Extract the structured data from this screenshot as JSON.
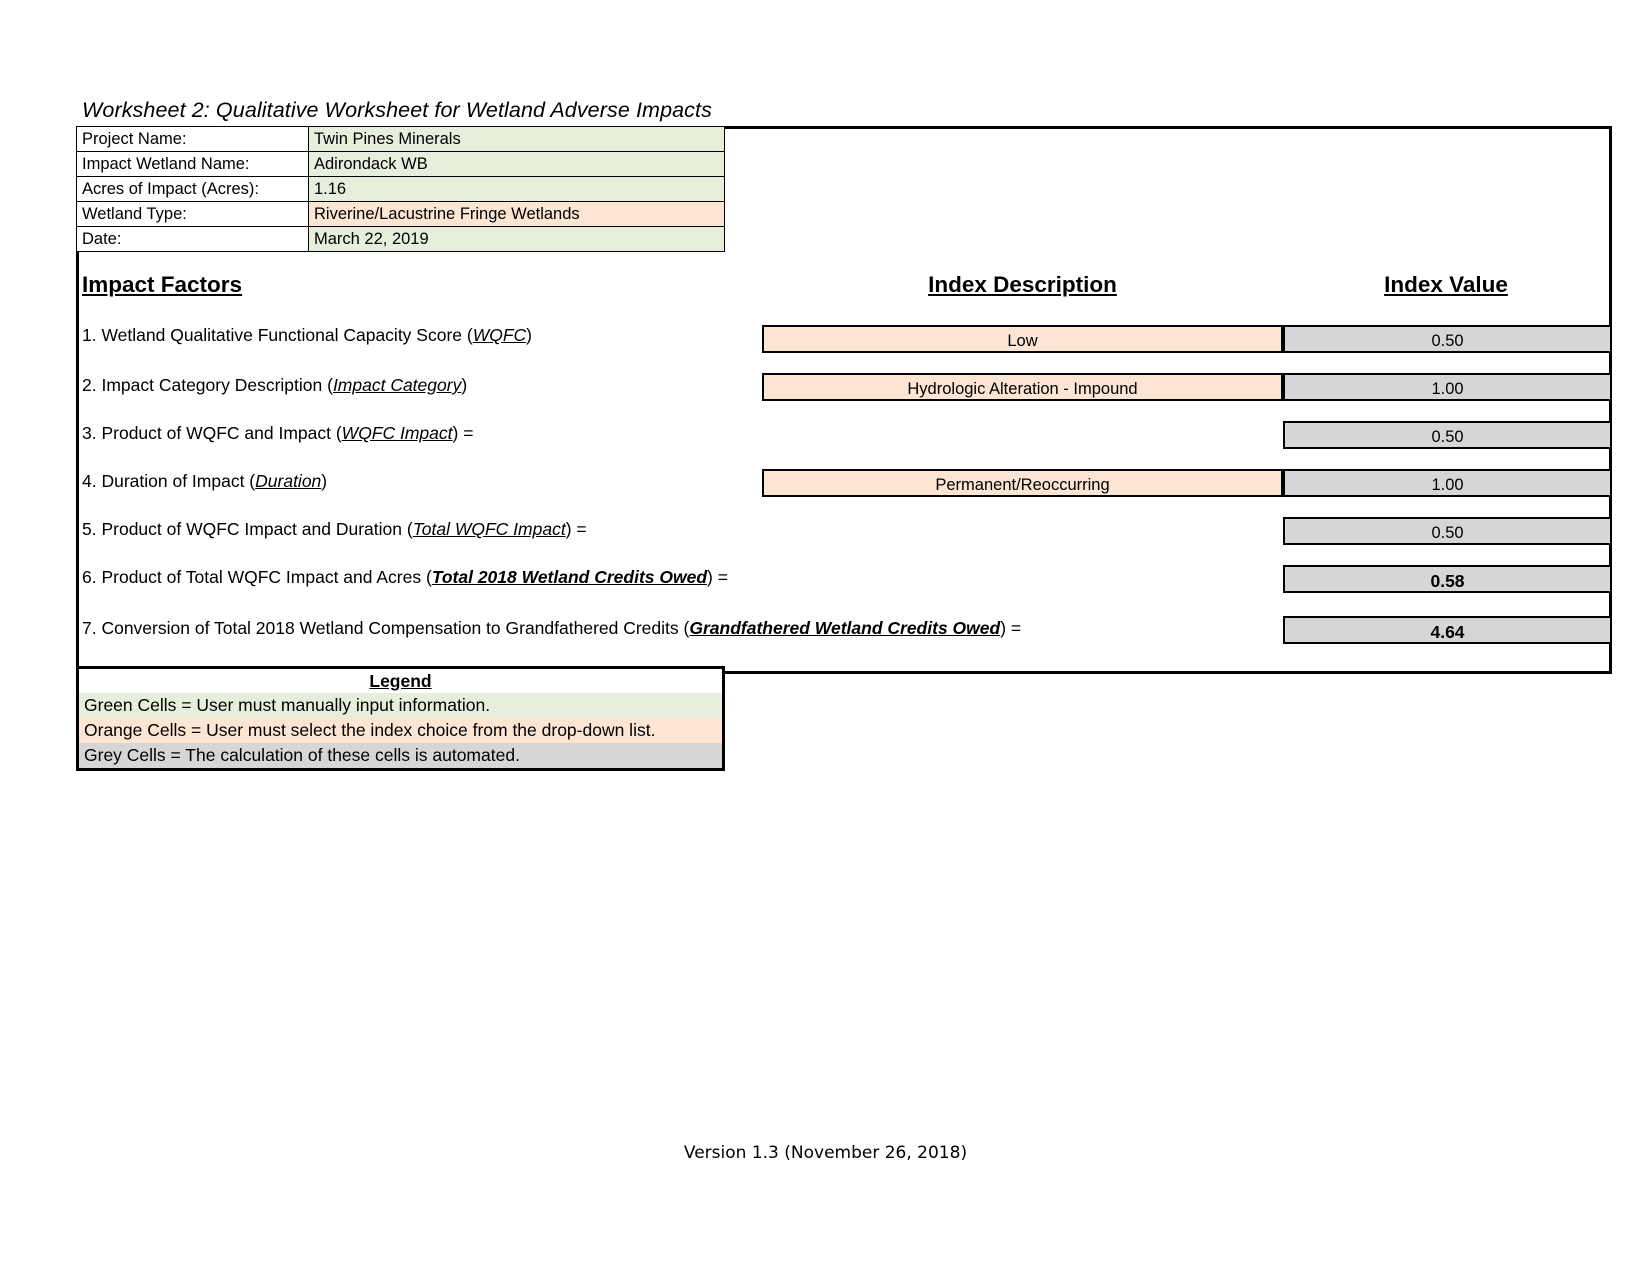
{
  "worksheet": {
    "title": "Worksheet 2:  Qualitative Worksheet for Wetland Adverse Impacts"
  },
  "project_info": {
    "rows": [
      {
        "label": "Project Name:",
        "value": "Twin Pines Minerals",
        "cell_type": "green"
      },
      {
        "label": "Impact Wetland Name:",
        "value": "Adirondack WB",
        "cell_type": "green"
      },
      {
        "label": "Acres of Impact (Acres):",
        "value": "1.16",
        "cell_type": "green"
      },
      {
        "label": "Wetland Type:",
        "value": "Riverine/Lacustrine Fringe Wetlands",
        "cell_type": "orange"
      },
      {
        "label": "Date:",
        "value": "March 22, 2019",
        "cell_type": "green"
      }
    ]
  },
  "headers": {
    "impact_factors": "Impact Factors",
    "index_description": "Index Description",
    "index_value": "Index Value"
  },
  "factors": [
    {
      "number": "1.",
      "text_before": "1. Wetland Qualitative Functional Capacity Score (",
      "term": "WQFC",
      "text_after": ")",
      "term_style": "italic",
      "description": "Low",
      "value": "0.50",
      "has_description": true,
      "value_bold": false
    },
    {
      "number": "2.",
      "text_before": "2. Impact Category Description (",
      "term": "Impact Category",
      "text_after": ")",
      "term_style": "italic",
      "description": "Hydrologic Alteration - Impound",
      "value": "1.00",
      "has_description": true,
      "value_bold": false
    },
    {
      "number": "3.",
      "text_before": "3. Product of WQFC and Impact (",
      "term": "WQFC Impact",
      "text_after": ") =",
      "term_style": "italic",
      "description": "",
      "value": "0.50",
      "has_description": false,
      "value_bold": false
    },
    {
      "number": "4.",
      "text_before": "4. Duration of Impact (",
      "term": "Duration",
      "text_after": ")",
      "term_style": "italic",
      "description": "Permanent/Reoccurring",
      "value": "1.00",
      "has_description": true,
      "value_bold": false
    },
    {
      "number": "5.",
      "text_before": "5. Product of WQFC Impact and Duration (",
      "term": "Total WQFC Impact",
      "text_after": ") =",
      "term_style": "italic",
      "description": "",
      "value": "0.50",
      "has_description": false,
      "value_bold": false
    },
    {
      "number": "6.",
      "text_before": "6. Product of Total WQFC Impact and Acres (",
      "term": "Total 2018 Wetland Credits Owed",
      "text_after": ") =",
      "term_style": "bold",
      "description": "",
      "value": "0.58",
      "has_description": false,
      "value_bold": true
    },
    {
      "number": "7.",
      "text_before": "7. Conversion of Total 2018 Wetland Compensation to Grandfathered Credits (",
      "term": "Grandfathered Wetland Credits Owed",
      "text_after": ") =",
      "term_style": "bold",
      "description": "",
      "value": "4.64",
      "has_description": false,
      "value_bold": true
    }
  ],
  "legend": {
    "title": "Legend",
    "rows": [
      {
        "text": "Green Cells = User must manually input information.",
        "cell_type": "green"
      },
      {
        "text": "Orange Cells = User must select the index choice from the drop-down list.",
        "cell_type": "orange"
      },
      {
        "text": "Grey Cells = The calculation of these cells is automated.",
        "cell_type": "grey"
      }
    ]
  },
  "footer": {
    "version": "Version 1.3 (November 26, 2018)"
  },
  "colors": {
    "green_cell": "#e8eedc",
    "orange_cell": "#fce5d3",
    "grey_cell": "#d6d6d6",
    "border": "#000000",
    "page_background": "#ffffff"
  }
}
